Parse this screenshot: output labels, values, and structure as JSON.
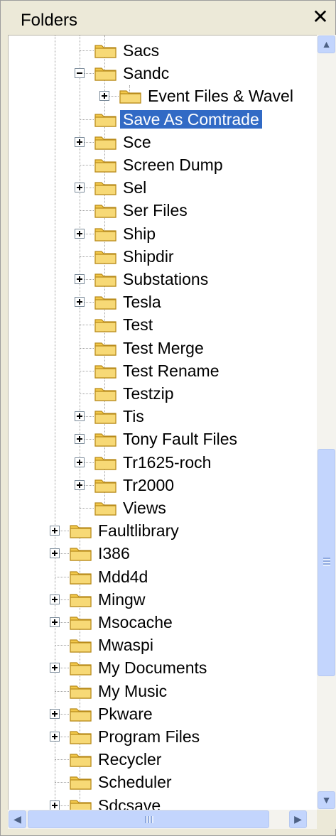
{
  "header": {
    "title": "Folders",
    "close_glyph": "✕",
    "close_icon": "close-icon"
  },
  "tree": {
    "items": [
      {
        "label": "Sacs",
        "depth": 3,
        "expander": "none",
        "selected": false
      },
      {
        "label": "Sandc",
        "depth": 3,
        "expander": "minus",
        "selected": false
      },
      {
        "label": "Event Files & Wavel",
        "depth": 4,
        "expander": "plus",
        "selected": false
      },
      {
        "label": "Save As Comtrade",
        "depth": 3,
        "expander": "none",
        "selected": true
      },
      {
        "label": "Sce",
        "depth": 3,
        "expander": "plus",
        "selected": false
      },
      {
        "label": "Screen Dump",
        "depth": 3,
        "expander": "none",
        "selected": false
      },
      {
        "label": "Sel",
        "depth": 3,
        "expander": "plus",
        "selected": false
      },
      {
        "label": "Ser Files",
        "depth": 3,
        "expander": "none",
        "selected": false
      },
      {
        "label": "Ship",
        "depth": 3,
        "expander": "plus",
        "selected": false
      },
      {
        "label": "Shipdir",
        "depth": 3,
        "expander": "none",
        "selected": false
      },
      {
        "label": "Substations",
        "depth": 3,
        "expander": "plus",
        "selected": false
      },
      {
        "label": "Tesla",
        "depth": 3,
        "expander": "plus",
        "selected": false
      },
      {
        "label": "Test",
        "depth": 3,
        "expander": "none",
        "selected": false
      },
      {
        "label": "Test Merge",
        "depth": 3,
        "expander": "none",
        "selected": false
      },
      {
        "label": "Test Rename",
        "depth": 3,
        "expander": "none",
        "selected": false
      },
      {
        "label": "Testzip",
        "depth": 3,
        "expander": "none",
        "selected": false
      },
      {
        "label": "Tis",
        "depth": 3,
        "expander": "plus",
        "selected": false
      },
      {
        "label": "Tony Fault Files",
        "depth": 3,
        "expander": "plus",
        "selected": false
      },
      {
        "label": "Tr1625-roch",
        "depth": 3,
        "expander": "plus",
        "selected": false
      },
      {
        "label": "Tr2000",
        "depth": 3,
        "expander": "plus",
        "selected": false
      },
      {
        "label": "Views",
        "depth": 3,
        "expander": "none",
        "selected": false
      },
      {
        "label": "Faultlibrary",
        "depth": 2,
        "expander": "plus",
        "selected": false
      },
      {
        "label": "I386",
        "depth": 2,
        "expander": "plus",
        "selected": false
      },
      {
        "label": "Mdd4d",
        "depth": 2,
        "expander": "none",
        "selected": false
      },
      {
        "label": "Mingw",
        "depth": 2,
        "expander": "plus",
        "selected": false
      },
      {
        "label": "Msocache",
        "depth": 2,
        "expander": "plus",
        "selected": false
      },
      {
        "label": "Mwaspi",
        "depth": 2,
        "expander": "none",
        "selected": false
      },
      {
        "label": "My Documents",
        "depth": 2,
        "expander": "plus",
        "selected": false
      },
      {
        "label": "My Music",
        "depth": 2,
        "expander": "none",
        "selected": false
      },
      {
        "label": "Pkware",
        "depth": 2,
        "expander": "plus",
        "selected": false
      },
      {
        "label": "Program Files",
        "depth": 2,
        "expander": "plus",
        "selected": false
      },
      {
        "label": "Recycler",
        "depth": 2,
        "expander": "none",
        "selected": false
      },
      {
        "label": "Scheduler",
        "depth": 2,
        "expander": "none",
        "selected": false
      },
      {
        "label": "Sdcsave",
        "depth": 2,
        "expander": "plus",
        "selected": false
      }
    ]
  },
  "scrollbars": {
    "vertical": {
      "up_glyph": "▲",
      "down_glyph": "▼",
      "thumb_grip": "≡"
    },
    "horizontal": {
      "left_glyph": "◀",
      "right_glyph": "▶",
      "thumb_grip": "III"
    }
  },
  "colors": {
    "selection": "#316ac5",
    "folder_fill": "#f2c84b",
    "folder_edge": "#b88a1b",
    "scroll_accent": "#c3d5fd"
  }
}
